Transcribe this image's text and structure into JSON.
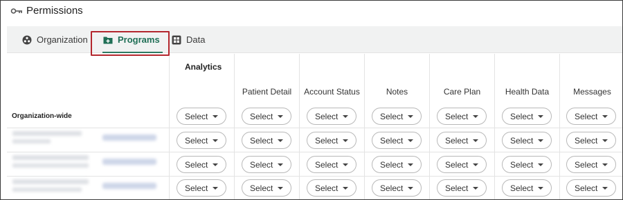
{
  "page": {
    "title": "Permissions",
    "title_icon": "key-icon"
  },
  "tabs": [
    {
      "label": "Organization",
      "icon": "organization-icon",
      "active": false
    },
    {
      "label": "Programs",
      "icon": "folder-plus-icon",
      "active": true
    },
    {
      "label": "Data",
      "icon": "grid-icon",
      "active": false
    }
  ],
  "colors": {
    "accent": "#1f6e55",
    "highlight_border": "#b3262d",
    "tabbar_bg": "#f1f2f2"
  },
  "table": {
    "group_header": "Analytics",
    "row_header_label": "Organization-wide",
    "columns": [
      "Patient Detail",
      "Account Status",
      "Notes",
      "Care Plan",
      "Health Data",
      "Messages"
    ],
    "select_label": "Select"
  }
}
